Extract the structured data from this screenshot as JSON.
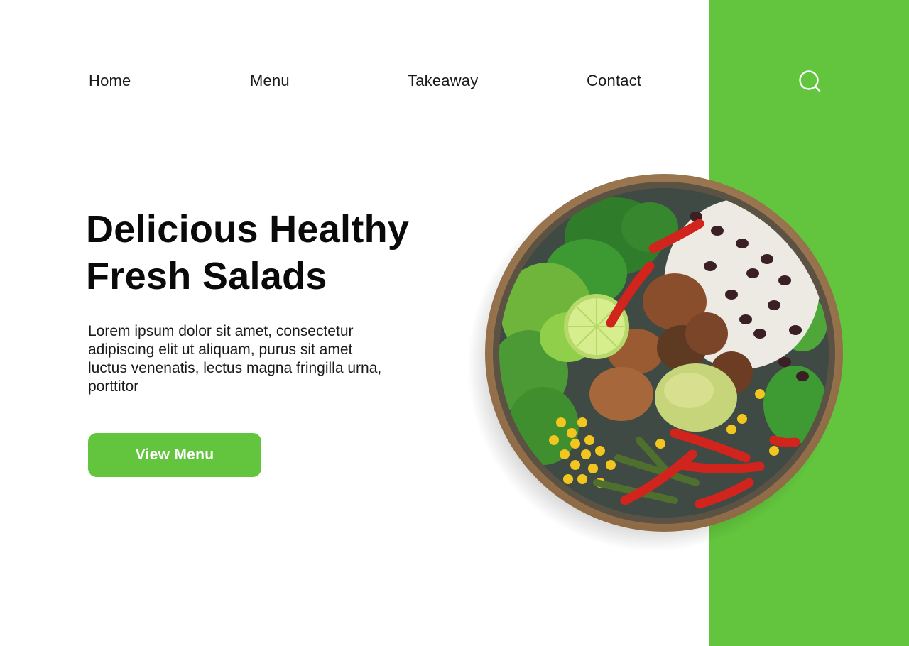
{
  "theme": {
    "accent": "#62c53d",
    "text": "#111111",
    "background": "#ffffff"
  },
  "nav": {
    "items": [
      {
        "label": "Home"
      },
      {
        "label": "Menu"
      },
      {
        "label": "Takeaway"
      },
      {
        "label": "Contact"
      }
    ],
    "search_icon": "search-icon"
  },
  "hero": {
    "title_lines": [
      "Delicious Healthy",
      "Fresh Salads"
    ],
    "description_lines": [
      "Lorem ipsum dolor sit amet, consectetur",
      "adipiscing elit ut aliquam, purus sit amet",
      "luctus venenatis, lectus magna fringilla urna,",
      "porttitor"
    ],
    "cta_label": "View Menu"
  },
  "image": {
    "subject": "salad-bowl-image"
  }
}
